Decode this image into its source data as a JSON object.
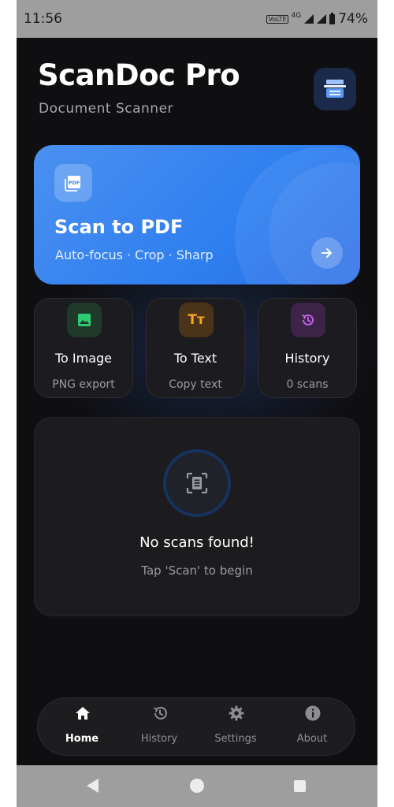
{
  "status_bar": {
    "time": "11:56",
    "volte": "VoLTE",
    "network": "4G",
    "battery": "74%"
  },
  "header": {
    "title": "ScanDoc Pro",
    "subtitle": "Document Scanner",
    "app_icon": "scanner-icon"
  },
  "hero_card": {
    "icon": "pdf-icon",
    "icon_text": "PDF",
    "title": "Scan to PDF",
    "subtitle": "Auto-focus · Crop · Sharp",
    "action_icon": "arrow-right-icon",
    "color": "#3b86f0"
  },
  "tiles": [
    {
      "title": "To Image",
      "subtitle": "PNG export",
      "icon": "image-icon",
      "accent": "#2ecc71"
    },
    {
      "title": "To Text",
      "subtitle": "Copy text",
      "icon": "text-format-icon",
      "icon_text": "Tт",
      "accent": "#f5a623"
    },
    {
      "title": "History",
      "subtitle": "0 scans",
      "icon": "history-icon",
      "accent": "#c160e8"
    }
  ],
  "empty_state": {
    "icon": "document-scan-icon",
    "title": "No scans found!",
    "subtitle": "Tap 'Scan' to begin"
  },
  "bottom_nav": {
    "items": [
      {
        "label": "Home",
        "icon": "home-icon",
        "active": true
      },
      {
        "label": "History",
        "icon": "history-icon",
        "active": false
      },
      {
        "label": "Settings",
        "icon": "gear-icon",
        "active": false
      },
      {
        "label": "About",
        "icon": "info-icon",
        "active": false
      }
    ]
  },
  "system_nav": {
    "back": "back-icon",
    "home": "home-circle-icon",
    "recents": "recents-icon"
  }
}
